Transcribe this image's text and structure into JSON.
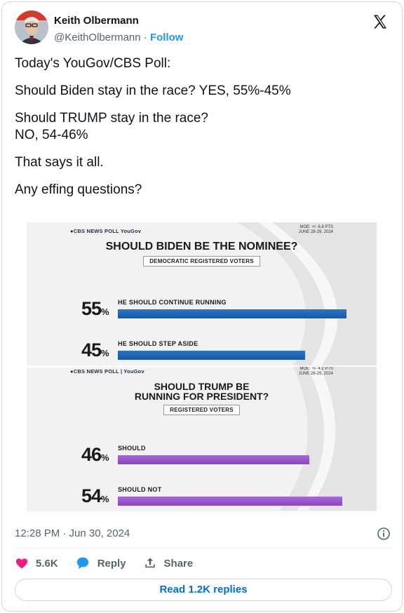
{
  "author": {
    "name": "Keith Olbermann",
    "handle": "@KeithOlbermann",
    "separator": "·",
    "follow_label": "Follow"
  },
  "icons": {
    "platform": "x-logo-icon",
    "info": "info-icon",
    "like": "heart-icon",
    "reply": "reply-bubble-icon",
    "share": "share-icon"
  },
  "tweet": {
    "paragraphs": [
      "Today's YouGov/CBS Poll:",
      "Should Biden stay in the race? YES, 55%-45%",
      "Should TRUMP stay in the race?\nNO, 54-46%",
      "That says it all.",
      "Any effing questions?"
    ],
    "timestamp": "12:28 PM · Jun 30, 2024"
  },
  "media": {
    "polls": [
      {
        "brand": "●CBS NEWS POLL  YouGov",
        "moe": "MOE: +/- 6.8 PTS\nJUNE 28-29, 2024",
        "title": "SHOULD BIDEN BE THE NOMINEE?",
        "subtitle": "DEMOCRATIC REGISTERED VOTERS",
        "bar_color": "#1a62b0",
        "rows": [
          {
            "pct": "55",
            "label": "HE SHOULD CONTINUE RUNNING",
            "value": 55
          },
          {
            "pct": "45",
            "label": "HE SHOULD STEP ASIDE",
            "value": 45
          }
        ]
      },
      {
        "brand": "●CBS NEWS POLL | YouGov",
        "moe": "MOE: +/- 4.2 PTS\nJUNE 28-29, 2024",
        "title": "SHOULD TRUMP BE\nRUNNING FOR PRESIDENT?",
        "subtitle": "REGISTERED VOTERS",
        "bar_color": "#9553cc",
        "rows": [
          {
            "pct": "46",
            "label": "SHOULD",
            "value": 46
          },
          {
            "pct": "54",
            "label": "SHOULD NOT",
            "value": 54
          }
        ]
      }
    ],
    "pct_suffix": "%"
  },
  "actions": {
    "likes": "5.6K",
    "reply_label": "Reply",
    "share_label": "Share",
    "read_replies_label": "Read 1.2K replies"
  },
  "colors": {
    "accent": "#1d9bf0",
    "like": "#f91880",
    "link": "#006fd6"
  }
}
